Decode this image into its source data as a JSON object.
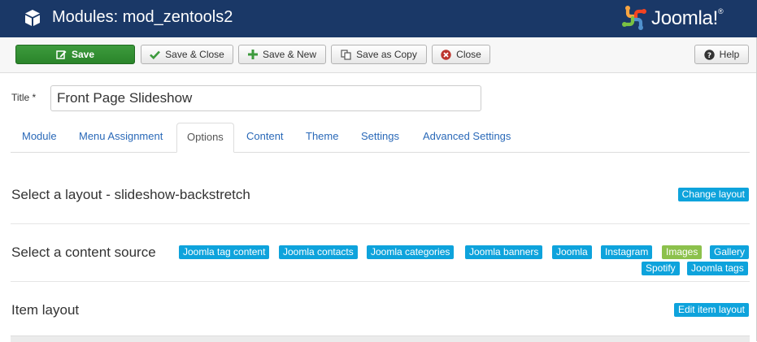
{
  "header": {
    "title": "Modules: mod_zentools2",
    "logo_text": "Joomla!",
    "logo_reg": "®"
  },
  "toolbar": {
    "save": "Save",
    "save_close": "Save & Close",
    "save_new": "Save & New",
    "save_copy": "Save as Copy",
    "close": "Close",
    "help": "Help"
  },
  "form": {
    "title_label": "Title *",
    "title_value": "Front Page Slideshow"
  },
  "tabs": [
    "Module",
    "Menu Assignment",
    "Options",
    "Content",
    "Theme",
    "Settings",
    "Advanced Settings"
  ],
  "active_tab": "Options",
  "layout_section": {
    "title": "Select a layout - slideshow-backstretch",
    "button": "Change layout"
  },
  "content_section": {
    "title": "Select a content source",
    "sources": [
      "Joomla tag content",
      "Joomla contacts",
      "Joomla categories",
      "Joomla banners",
      "Joomla",
      "Instagram",
      "Images",
      "Gallery",
      "Spotify",
      "Joomla tags"
    ],
    "selected": "Images"
  },
  "item_section": {
    "title": "Item layout",
    "button": "Edit item layout"
  },
  "colors": {
    "header_bg": "#1a3867",
    "save_green": "#2f8f2f",
    "badge_blue": "#0ea3dc",
    "badge_green_selected": "#8cc14c",
    "link_blue": "#2a69b8"
  },
  "icons": {
    "header": "cube-icon",
    "save": "edit-icon",
    "save_close": "check-icon",
    "save_new": "plus-icon",
    "save_copy": "copy-icon",
    "close": "close-circle-icon",
    "help": "question-circle-icon"
  }
}
